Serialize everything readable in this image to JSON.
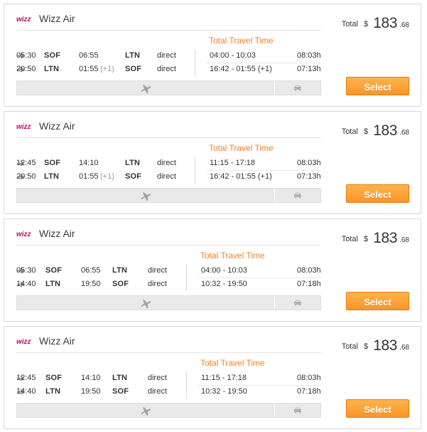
{
  "brand": {
    "accent": "#f58220",
    "airline_purple": "#b50f6b",
    "button_orange": "#f79628",
    "neutral_gray": "#e9e9e9"
  },
  "results": [
    {
      "airline": "Wizz Air",
      "logo_text": "wizz",
      "travel_time_title": "Total Travel Time",
      "price": {
        "label": "Total",
        "currency": "$",
        "amount": "183",
        "cents": ".68"
      },
      "select_label": "Select",
      "segments": [
        {
          "depart": "05:30",
          "from": "SOF",
          "arrive": "06:55",
          "to": "LTN",
          "stops": "direct",
          "travel_window": "04:00 - 10:03",
          "duration": "08:03h"
        },
        {
          "depart": "20:50",
          "from": "LTN",
          "arrive": "01:55",
          "next_day": "(+1)",
          "to": "SOF",
          "stops": "direct",
          "travel_window": "16:42 - 01:55 (+1)",
          "duration": "07:13h"
        }
      ],
      "icons": {
        "flight": "plane-icon",
        "ground": "car-icon"
      }
    },
    {
      "airline": "Wizz Air",
      "logo_text": "wizz",
      "travel_time_title": "Total Travel Time",
      "price": {
        "label": "Total",
        "currency": "$",
        "amount": "183",
        "cents": ".68"
      },
      "select_label": "Select",
      "segments": [
        {
          "depart": "12:45",
          "from": "SOF",
          "arrive": "14:10",
          "to": "LTN",
          "stops": "direct",
          "travel_window": "11:15 - 17:18",
          "duration": "08:03h"
        },
        {
          "depart": "20:50",
          "from": "LTN",
          "arrive": "01:55",
          "next_day": "(+1)",
          "to": "SOF",
          "stops": "direct",
          "travel_window": "16:42 - 01:55 (+1)",
          "duration": "07:13h"
        }
      ],
      "icons": {
        "flight": "plane-icon",
        "ground": "car-icon"
      }
    },
    {
      "airline": "Wizz Air",
      "logo_text": "wizz",
      "travel_time_title": "Total Travel Time",
      "price": {
        "label": "Total",
        "currency": "$",
        "amount": "183",
        "cents": ".68"
      },
      "select_label": "Select",
      "segments": [
        {
          "depart": "05:30",
          "from": "SOF",
          "arrive": "06:55",
          "to": "LTN",
          "stops": "direct",
          "travel_window": "04:00 - 10:03",
          "duration": "08:03h"
        },
        {
          "depart": "14:40",
          "from": "LTN",
          "arrive": "19:50",
          "to": "SOF",
          "stops": "direct",
          "travel_window": "10:32 - 19:50",
          "duration": "07:18h"
        }
      ],
      "icons": {
        "flight": "plane-icon",
        "ground": "car-icon"
      }
    },
    {
      "airline": "Wizz Air",
      "logo_text": "wizz",
      "travel_time_title": "Total Travel Time",
      "price": {
        "label": "Total",
        "currency": "$",
        "amount": "183",
        "cents": ".68"
      },
      "select_label": "Select",
      "segments": [
        {
          "depart": "12:45",
          "from": "SOF",
          "arrive": "14:10",
          "to": "LTN",
          "stops": "direct",
          "travel_window": "11:15 - 17:18",
          "duration": "08:03h"
        },
        {
          "depart": "14:40",
          "from": "LTN",
          "arrive": "19:50",
          "to": "SOF",
          "stops": "direct",
          "travel_window": "10:32 - 19:50",
          "duration": "07:18h"
        }
      ],
      "icons": {
        "flight": "plane-icon",
        "ground": "car-icon"
      }
    }
  ]
}
